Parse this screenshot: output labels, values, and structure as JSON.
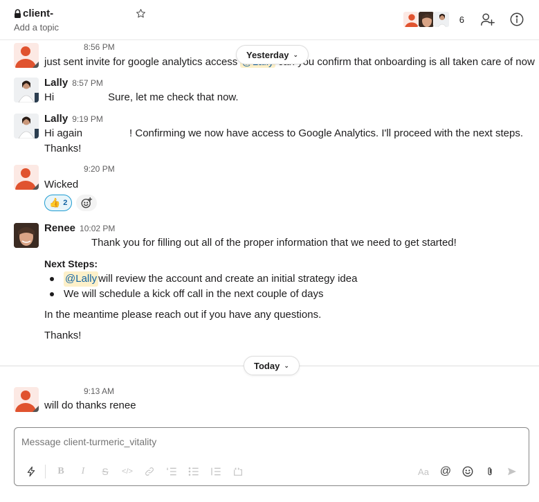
{
  "header": {
    "channel_name": "client-",
    "topic": "Add a topic",
    "member_count": "6",
    "icons": [
      "lock-icon",
      "star-icon",
      "add-member-icon",
      "info-icon"
    ]
  },
  "messages": [
    {
      "author": "",
      "time": "8:56 PM",
      "avatar": "default-user",
      "text_before": "just sent invite for google analytics access ",
      "mention": "@Lally",
      "text_after": " can you confirm that onboarding is all taken care of now"
    },
    {
      "author": "Lally",
      "time": "8:57 PM",
      "avatar": "lally",
      "text_before": "Hi",
      "text_after": "Sure, let me check that now."
    },
    {
      "author": "Lally",
      "time": "9:19 PM",
      "avatar": "lally",
      "text_before": "Hi again",
      "text_after": "! Confirming we now have access to Google Analytics. I'll proceed with the next steps.",
      "line2": "Thanks!"
    },
    {
      "author": "",
      "time": "9:20 PM",
      "avatar": "default-user",
      "text": "Wicked",
      "reactions": [
        {
          "emoji": "👍",
          "count": "2"
        }
      ]
    },
    {
      "author": "Renee",
      "time": "10:02 PM",
      "avatar": "renee",
      "line1": "Thank you for filling out all of the proper information that we need to get started!",
      "heading": "Next Steps:",
      "bullets": [
        {
          "mention": "@Lally",
          "text": " will review the account and create an initial strategy idea"
        },
        {
          "mention": "",
          "text": "We will schedule a kick off call in the next couple of days"
        }
      ],
      "para": "In the meantime please reach out if you have any questions.",
      "closing": "Thanks!"
    },
    {
      "author": "",
      "time": "9:13 AM",
      "avatar": "default-user",
      "text": "will do thanks renee"
    }
  ],
  "dividers": {
    "yesterday": "Yesterday",
    "today": "Today"
  },
  "composer": {
    "placeholder": "Message client-turmeric_vitality",
    "format_label": "Aa",
    "toolbar": [
      "shortcuts",
      "bold",
      "italic",
      "strikethrough",
      "code",
      "link",
      "ordered-list",
      "bulleted-list",
      "blockquote",
      "code-block",
      "formatting",
      "mention",
      "emoji",
      "attach",
      "send"
    ]
  },
  "colors": {
    "mention_bg": "#fdf0c9",
    "mention_fg": "#1264a3",
    "default_avatar": "#e0532f",
    "reaction_border": "#1d9bd1"
  }
}
